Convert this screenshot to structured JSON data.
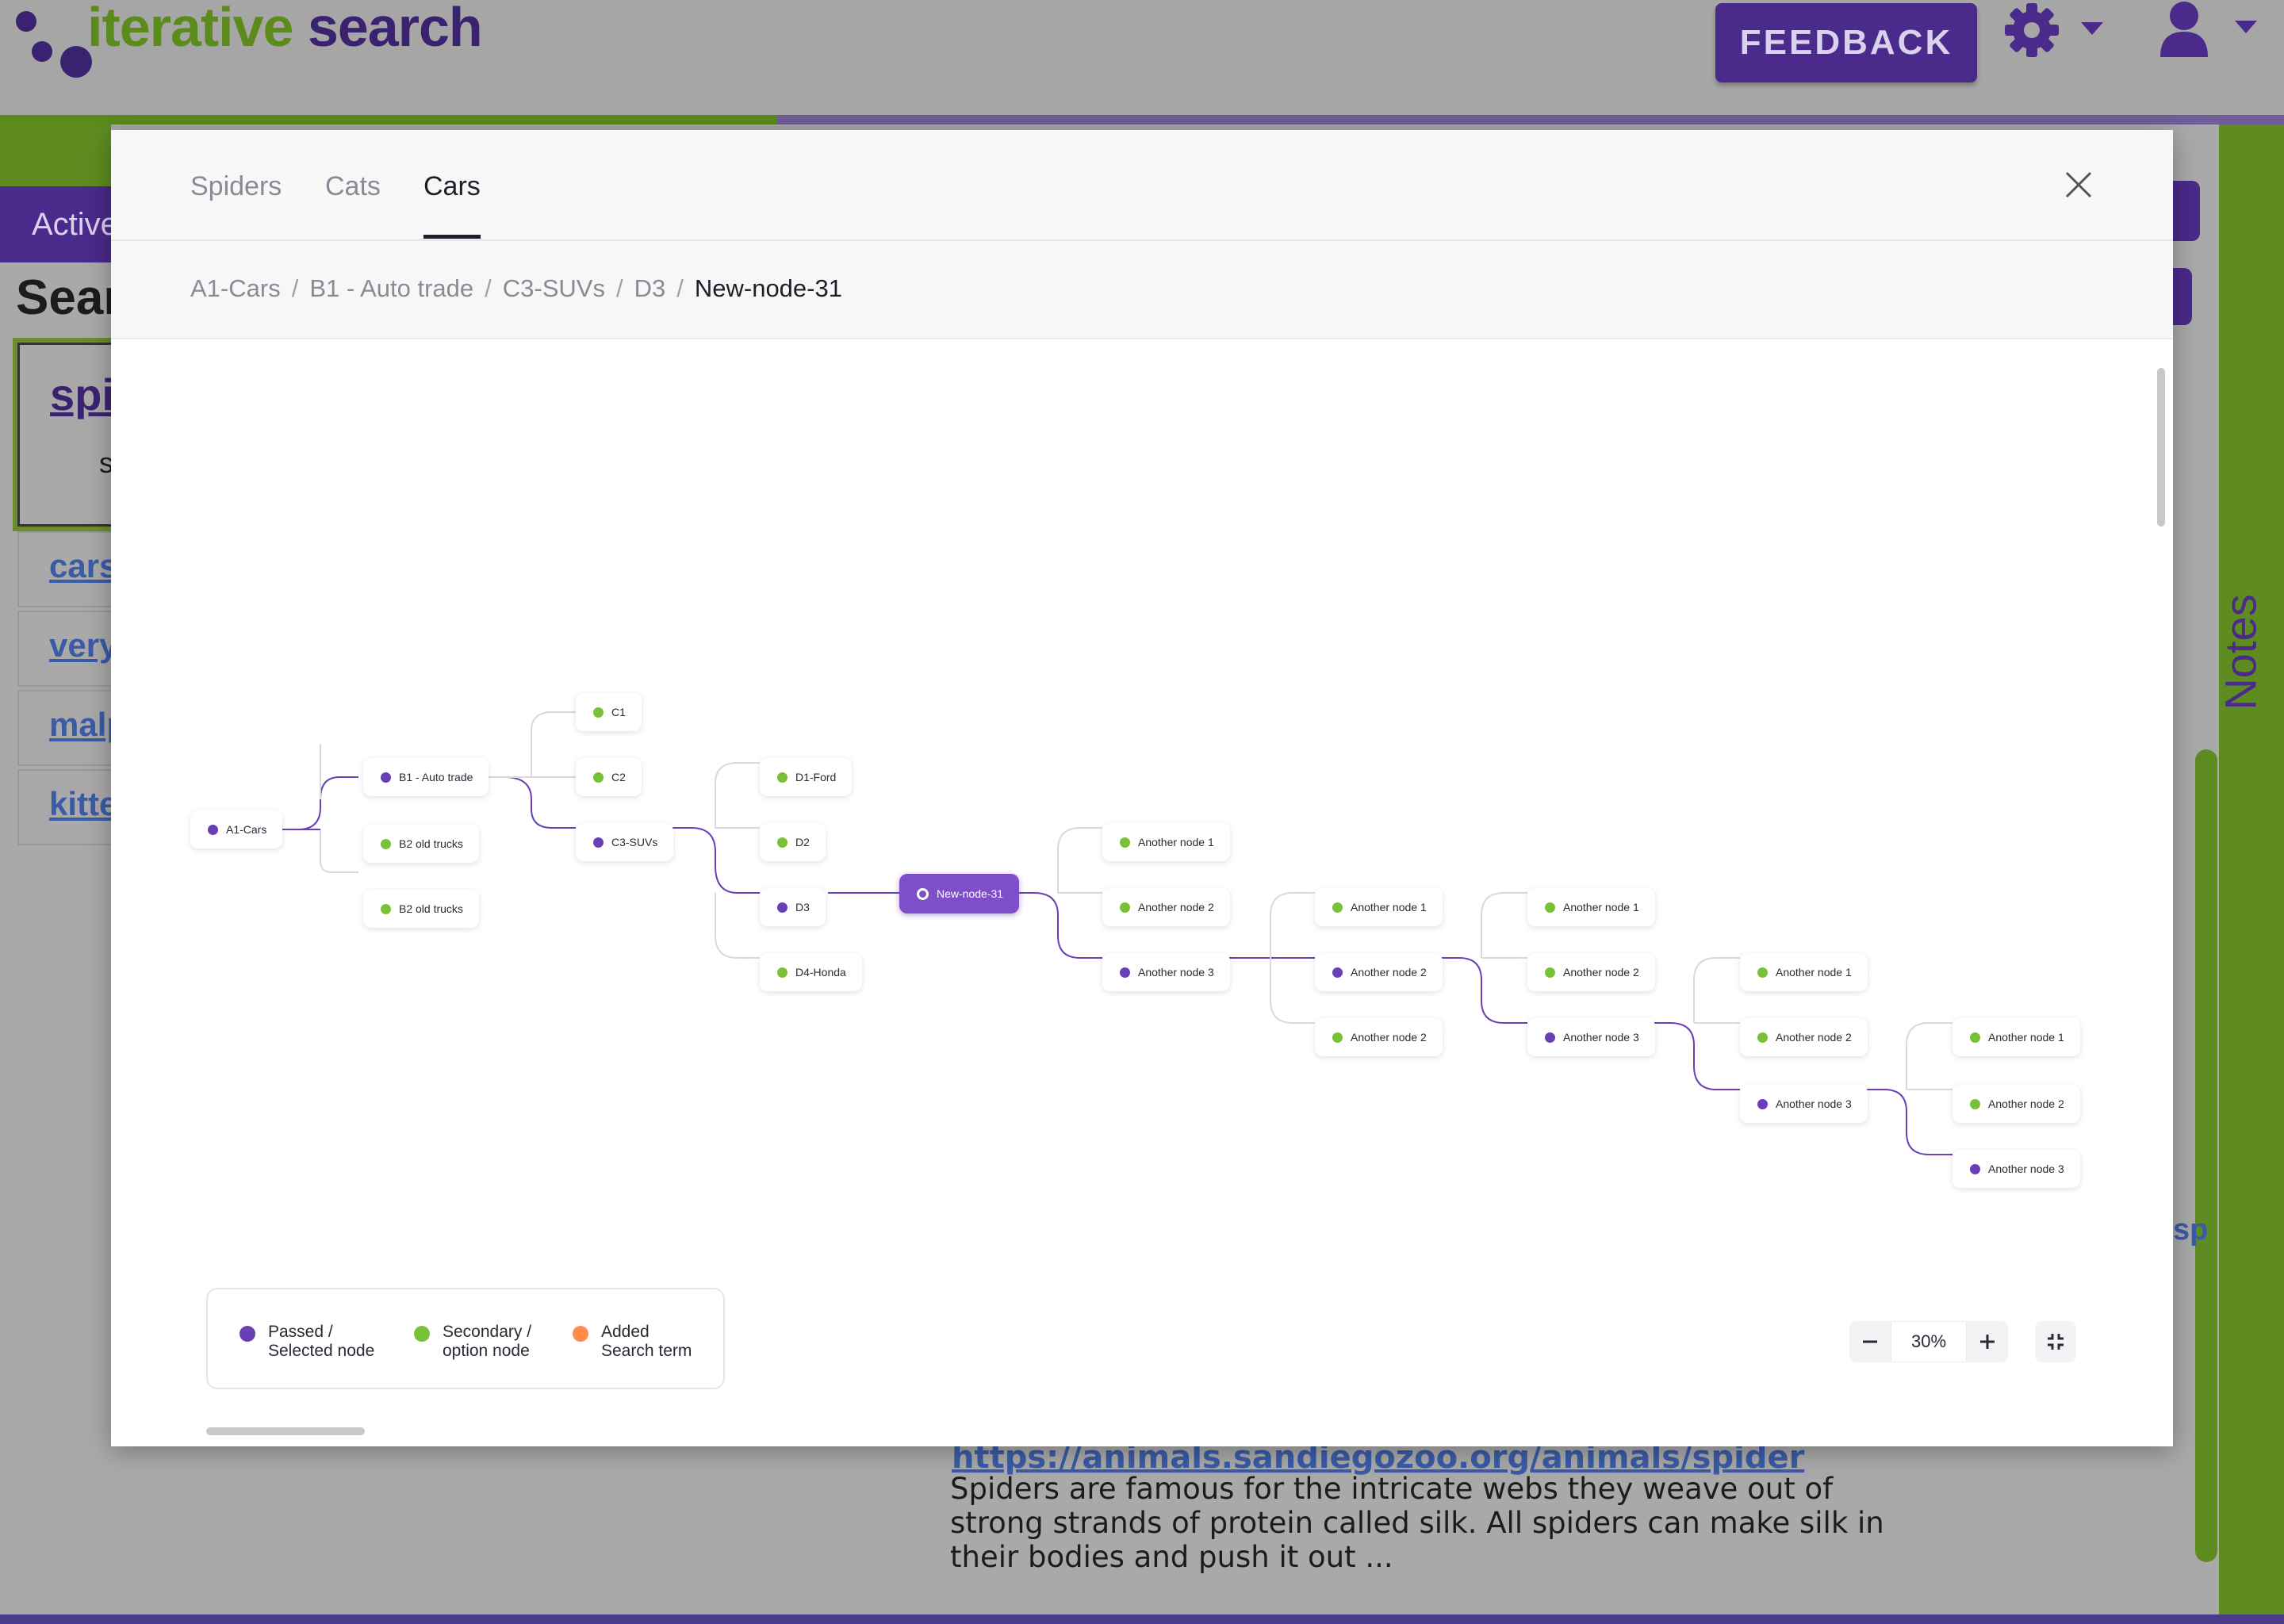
{
  "app": {
    "logo_word1": "iterative",
    "logo_word2": "search",
    "feedback_label": "FEEDBACK",
    "active_tab_label": "Active",
    "search_heading": "Sear",
    "result_title": "spi",
    "result_sub": "s",
    "links": [
      "cars",
      "very",
      "malp",
      "kitte"
    ],
    "notes_label": "Notes",
    "partial_link": "sp",
    "result_url": "https://animals.sandiegozoo.org/animals/spider",
    "result_snippet": "Spiders are famous for the intricate webs they weave out of strong strands of protein called silk. All spiders can make silk in their bodies and push it out ..."
  },
  "modal": {
    "tabs": [
      "Spiders",
      "Cats",
      "Cars"
    ],
    "active_tab": "Cars",
    "breadcrumb": [
      "A1-Cars",
      "B1 - Auto trade",
      "C3-SUVs",
      "D3",
      "New-node-31"
    ],
    "nodes": {
      "a1": "A1-Cars",
      "b1": "B1 - Auto trade",
      "b2a": "B2 old trucks",
      "b2b": "B2 old trucks",
      "c1": "C1",
      "c2": "C2",
      "c3": "C3-SUVs",
      "d1": "D1-Ford",
      "d2": "D2",
      "d3": "D3",
      "d4": "D4-Honda",
      "new31": "New-node-31",
      "e1": "Another node 1",
      "e2": "Another node 2",
      "e3": "Another node 3",
      "f1": "Another node 1",
      "f2": "Another node 2",
      "f3": "Another node 2",
      "g1": "Another node 1",
      "g2": "Another node 2",
      "g3": "Another node 3",
      "h1": "Another node 1",
      "h2": "Another node 2",
      "h3": "Another node 3",
      "i1": "Another node 1",
      "i2": "Another node 2",
      "i3": "Another node 3"
    },
    "legend": {
      "passed_line1": "Passed /",
      "passed_line2": "Selected node",
      "secondary_line1": "Secondary /",
      "secondary_line2": "option node",
      "added_line1": "Added",
      "added_line2": "Search term"
    },
    "zoom": "30%",
    "colors": {
      "passed": "#6a3fb4",
      "secondary": "#7ac13a",
      "added": "#ff8c4b",
      "selected": "#7e4fc8"
    }
  }
}
